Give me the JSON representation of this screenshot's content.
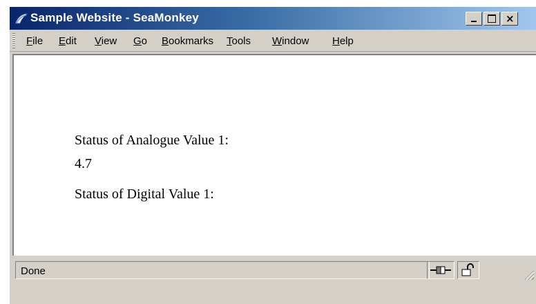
{
  "window": {
    "title": "Sample Website - SeaMonkey"
  },
  "menubar": {
    "items": [
      {
        "label": "File"
      },
      {
        "label": "Edit"
      },
      {
        "label": "View"
      },
      {
        "label": "Go"
      },
      {
        "label": "Bookmarks"
      },
      {
        "label": "Tools"
      },
      {
        "label": "Window"
      },
      {
        "label": "Help"
      }
    ]
  },
  "page": {
    "analogue_label": "Status of Analogue Value 1:",
    "analogue_value": "4.7",
    "digital_label": "Status of Digital Value 1:"
  },
  "statusbar": {
    "status_text": "Done"
  },
  "icons": {
    "app": "seamonkey-icon",
    "connection": "online-connection-icon",
    "security": "unlocked-padlock-icon"
  }
}
